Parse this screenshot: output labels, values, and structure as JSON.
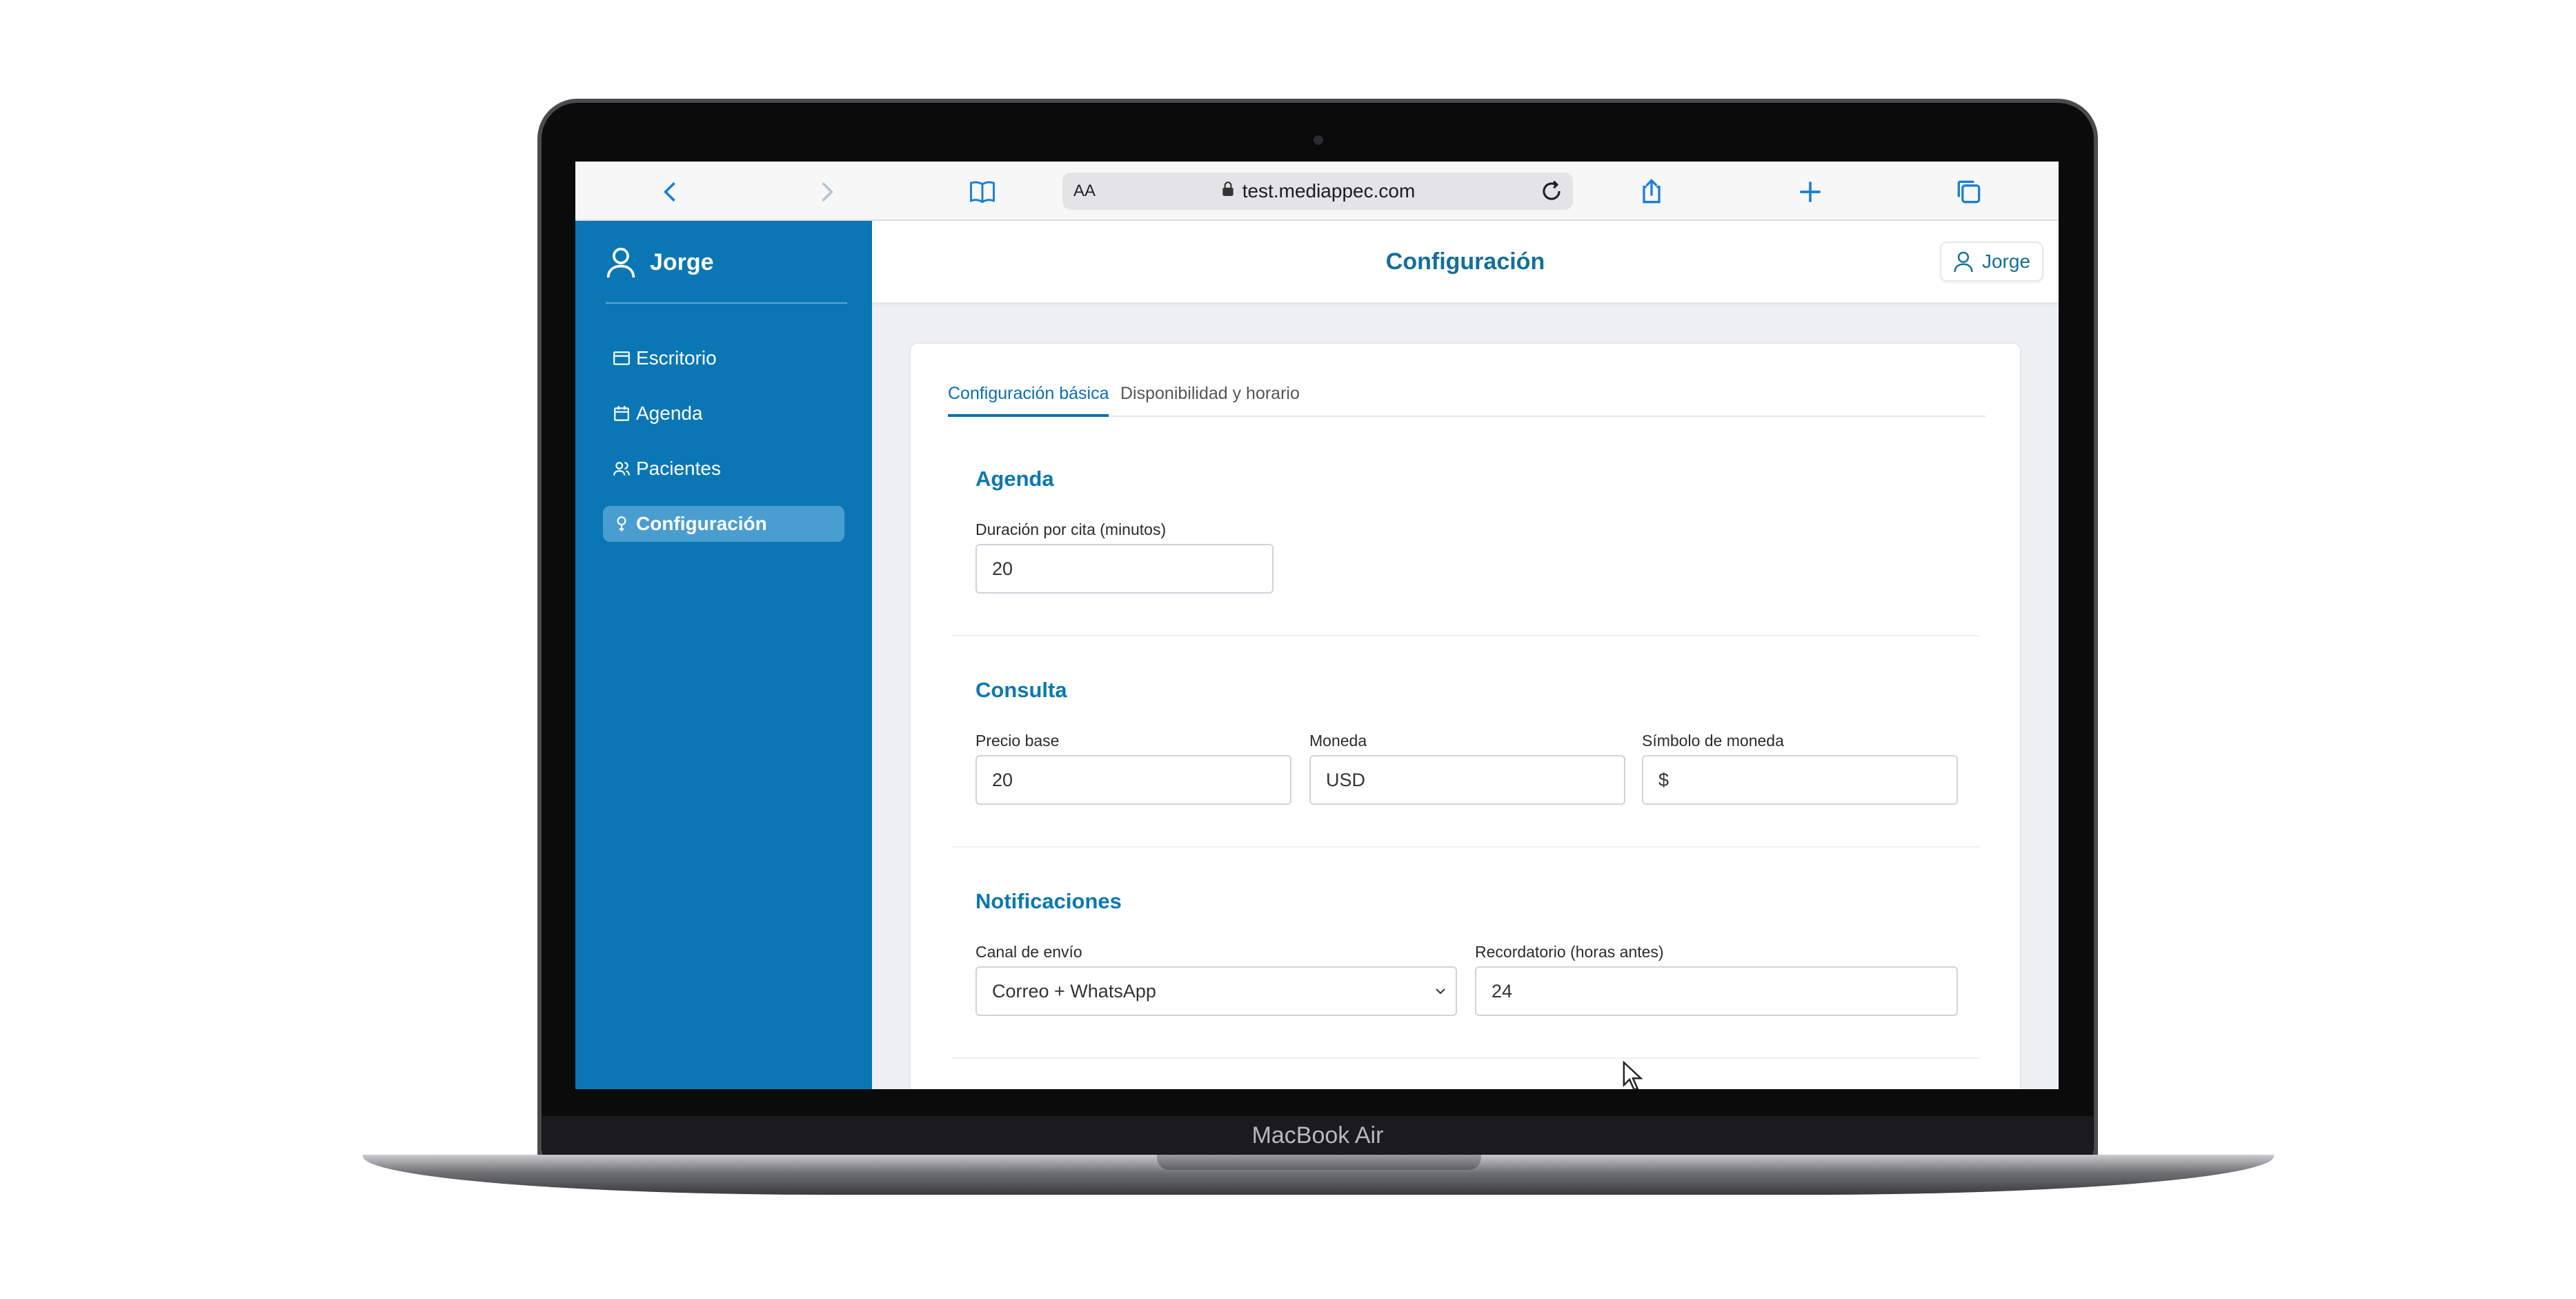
{
  "device": {
    "brand_label": "MacBook Air"
  },
  "browser": {
    "text_size_label": "AA",
    "url": "test.mediappec.com"
  },
  "sidebar": {
    "user_name": "Jorge",
    "items": [
      {
        "label": "Escritorio",
        "icon": "desktop-icon",
        "active": false
      },
      {
        "label": "Agenda",
        "icon": "calendar-icon",
        "active": false
      },
      {
        "label": "Pacientes",
        "icon": "users-icon",
        "active": false
      },
      {
        "label": "Configuración",
        "icon": "settings-icon",
        "active": true
      }
    ]
  },
  "header": {
    "title": "Configuración",
    "user_label": "Jorge"
  },
  "tabs": [
    {
      "label": "Configuración básica",
      "active": true
    },
    {
      "label": "Disponibilidad y horario",
      "active": false
    }
  ],
  "sections": {
    "agenda": {
      "title": "Agenda",
      "duration_label": "Duración por cita (minutos)",
      "duration_value": "20"
    },
    "consulta": {
      "title": "Consulta",
      "base_price_label": "Precio base",
      "base_price_value": "20",
      "currency_label": "Moneda",
      "currency_value": "USD",
      "currency_symbol_label": "Símbolo de moneda",
      "currency_symbol_value": "$"
    },
    "notificaciones": {
      "title": "Notificaciones",
      "channel_label": "Canal de envío",
      "channel_value": "Correo + WhatsApp",
      "reminder_label": "Recordatorio (horas antes)",
      "reminder_value": "24"
    }
  },
  "colors": {
    "sidebar_bg": "#0a77b4",
    "sidebar_active_bg": "#4a9dd0",
    "accent": "#0a6fb0"
  }
}
